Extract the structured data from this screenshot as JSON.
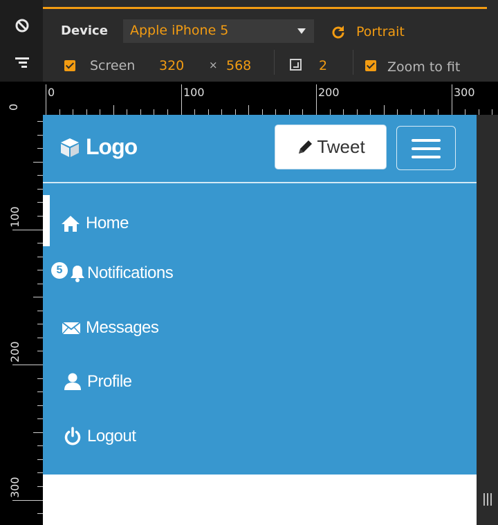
{
  "toolbar": {
    "device_label": "Device",
    "device_value": "Apple iPhone 5",
    "orientation_label": "Portrait",
    "screen_label": "Screen",
    "screen_width": "320",
    "times": "×",
    "screen_height": "568",
    "pixel_ratio": "2",
    "zoom_label": "Zoom to fit",
    "screen_checked": true,
    "zoom_checked": true,
    "accent_color": "#f39c12"
  },
  "ruler_top": {
    "labels": [
      "0",
      "100",
      "200",
      "300"
    ]
  },
  "ruler_left": {
    "labels": [
      "0",
      "100",
      "200",
      "300"
    ]
  },
  "app": {
    "brand": "Logo",
    "tweet_button": "Tweet",
    "navbar_color": "#3897cf",
    "nav": [
      {
        "label": "Home",
        "icon": "home-icon",
        "active": true
      },
      {
        "label": "Notifications",
        "icon": "bell-icon",
        "badge": "5"
      },
      {
        "label": "Messages",
        "icon": "envelope-icon"
      },
      {
        "label": "Profile",
        "icon": "user-icon"
      },
      {
        "label": "Logout",
        "icon": "power-icon"
      }
    ]
  }
}
